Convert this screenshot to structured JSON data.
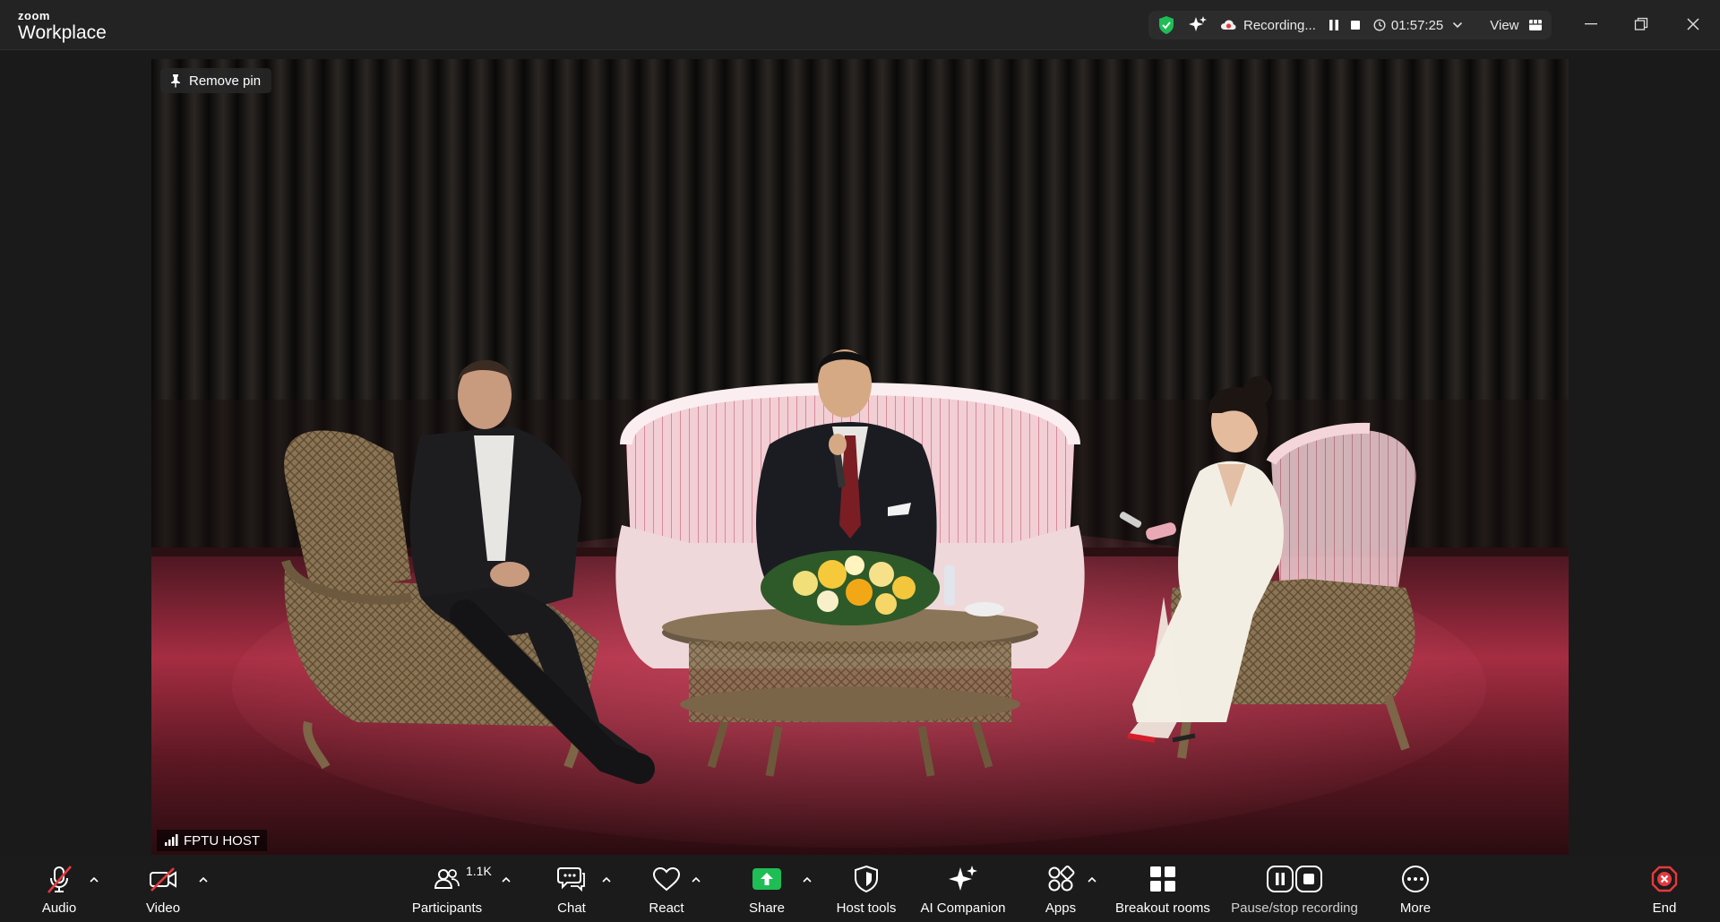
{
  "app": {
    "brand_small": "zoom",
    "brand_name": "Workplace"
  },
  "recording": {
    "status": "Recording...",
    "elapsed": "01:57:25",
    "view_label": "View"
  },
  "video": {
    "pin_label": "Remove pin",
    "participant_name": "FPTU HOST"
  },
  "toolbar": {
    "audio": "Audio",
    "video": "Video",
    "participants": "Participants",
    "participants_count": "1.1K",
    "chat": "Chat",
    "react": "React",
    "share": "Share",
    "host_tools": "Host tools",
    "ai_companion": "AI Companion",
    "apps": "Apps",
    "breakout_rooms": "Breakout rooms",
    "pause_stop_recording": "Pause/stop recording",
    "more": "More",
    "end": "End"
  },
  "colors": {
    "accent_green": "#1fbd55",
    "mute_red": "#e5393e",
    "end_red": "#e5393e",
    "security_green": "#1fbd55"
  }
}
